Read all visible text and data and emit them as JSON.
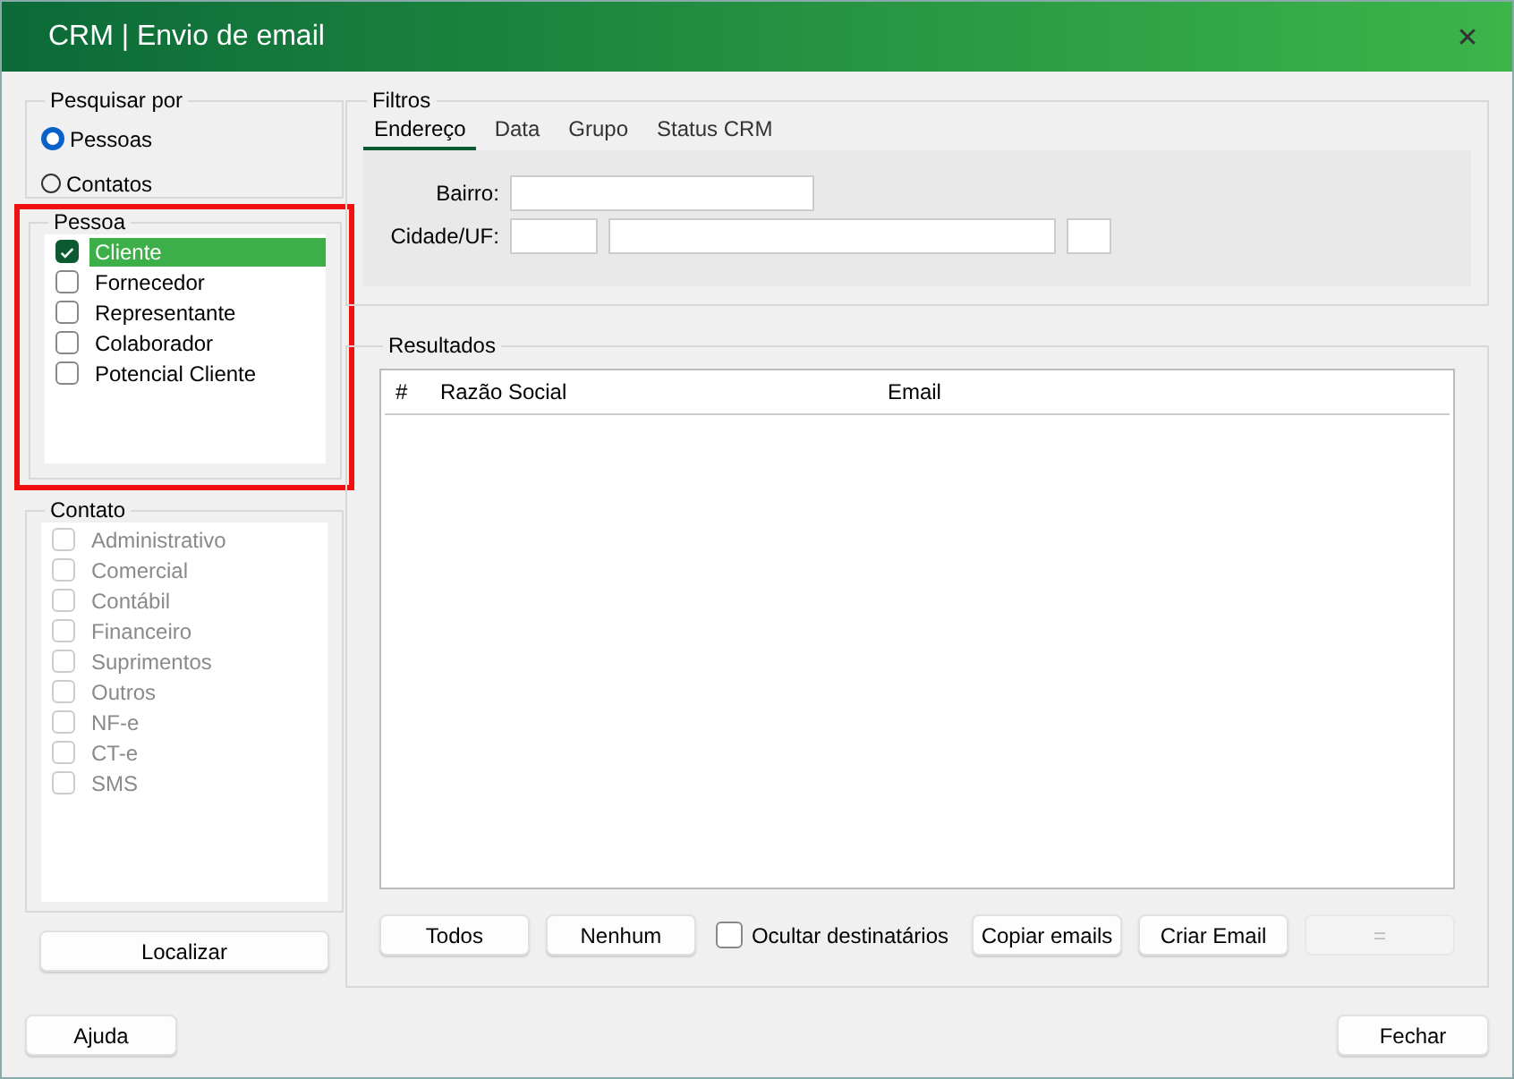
{
  "window": {
    "title": "CRM | Envio de email",
    "close": "✕"
  },
  "search_by": {
    "title": "Pesquisar por",
    "options": [
      {
        "label": "Pessoas",
        "selected": true
      },
      {
        "label": "Contatos",
        "selected": false
      }
    ]
  },
  "pessoa": {
    "title": "Pessoa",
    "highlighted": true,
    "items": [
      {
        "label": "Cliente",
        "checked": true,
        "selected": true,
        "disabled": false
      },
      {
        "label": "Fornecedor",
        "checked": false,
        "selected": false,
        "disabled": false
      },
      {
        "label": "Representante",
        "checked": false,
        "selected": false,
        "disabled": false
      },
      {
        "label": "Colaborador",
        "checked": false,
        "selected": false,
        "disabled": false
      },
      {
        "label": "Potencial Cliente",
        "checked": false,
        "selected": false,
        "disabled": false
      }
    ]
  },
  "contato": {
    "title": "Contato",
    "items": [
      {
        "label": "Administrativo",
        "checked": false,
        "selected": false,
        "disabled": true
      },
      {
        "label": "Comercial",
        "checked": false,
        "selected": false,
        "disabled": true
      },
      {
        "label": "Contábil",
        "checked": false,
        "selected": false,
        "disabled": true
      },
      {
        "label": "Financeiro",
        "checked": false,
        "selected": false,
        "disabled": true
      },
      {
        "label": "Suprimentos",
        "checked": false,
        "selected": false,
        "disabled": true
      },
      {
        "label": "Outros",
        "checked": false,
        "selected": false,
        "disabled": true
      },
      {
        "label": "NF-e",
        "checked": false,
        "selected": false,
        "disabled": true
      },
      {
        "label": "CT-e",
        "checked": false,
        "selected": false,
        "disabled": true
      },
      {
        "label": "SMS",
        "checked": false,
        "selected": false,
        "disabled": true
      }
    ]
  },
  "localizar_button": "Localizar",
  "filtros": {
    "title": "Filtros",
    "tabs": [
      {
        "label": "Endereço",
        "selected": true
      },
      {
        "label": "Data",
        "selected": false
      },
      {
        "label": "Grupo",
        "selected": false
      },
      {
        "label": "Status CRM",
        "selected": false
      }
    ],
    "bairro_label": "Bairro:",
    "cidade_label": "Cidade/UF:"
  },
  "resultados": {
    "title": "Resultados",
    "columns": [
      "#",
      "Razão Social",
      "Email"
    ],
    "buttons": [
      {
        "label": "Todos",
        "disabled": false
      },
      {
        "label": "Nenhum",
        "disabled": false
      }
    ],
    "hide_recipients": {
      "label": "Ocultar destinatários",
      "checked": false
    },
    "buttons_right": [
      {
        "label": "Copiar emails",
        "disabled": false
      },
      {
        "label": "Criar Email",
        "disabled": false
      },
      {
        "label": "=",
        "disabled": true
      }
    ]
  },
  "footer": {
    "help_button": "Ajuda",
    "close_button": "Fechar"
  }
}
